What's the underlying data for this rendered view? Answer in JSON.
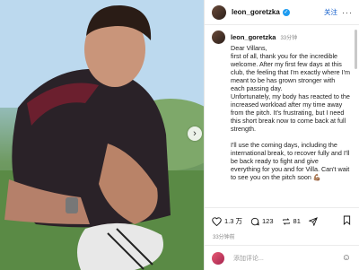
{
  "header": {
    "username": "leon_goretzka",
    "follow_label": "关注",
    "more_label": "···"
  },
  "post": {
    "username": "leon_goretzka",
    "time": "33分钟",
    "caption": [
      "Dear Villans,\nfirst of all, thank you for the incredible welcome. After my first few days at this club, the feeling that I'm exactly where I'm meant to be has grown stronger with each passing day.\nUnfortunately, my body has reacted to the increased workload after my time away from the pitch. It's frustrating, but I need this short break now to come back at full strength.",
      "I'll use the coming days, including the international break, to recover fully and I'll be back ready to fight and give everything for you and for Villa. Can't wait to see you on the pitch soon 💪🏽"
    ]
  },
  "actions": {
    "likes": "1.3 万",
    "comments": "123",
    "shares": "81"
  },
  "timestamp": "33分钟前",
  "comment_placeholder": "添加评论...",
  "icons": {
    "next": "chevron-right-icon",
    "like": "heart-icon",
    "comment": "comment-icon",
    "repost": "repost-icon",
    "share": "send-icon",
    "save": "bookmark-icon",
    "emoji": "smiley-icon"
  },
  "colors": {
    "verified": "#1d9bf0",
    "follow": "#0a58ca"
  }
}
